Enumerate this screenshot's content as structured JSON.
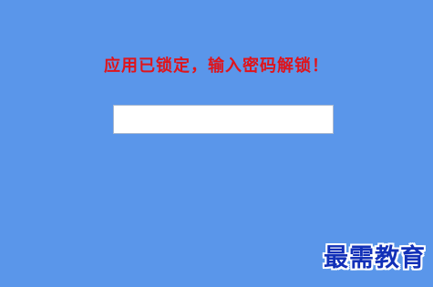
{
  "lock_screen": {
    "message": "应用已锁定，输入密码解锁！",
    "password_value": "",
    "password_placeholder": ""
  },
  "watermark": {
    "text": "最需教育"
  },
  "colors": {
    "background": "#5a96ea",
    "message": "#e0141b",
    "input_background": "#ffffff",
    "watermark": "#1230b8"
  }
}
